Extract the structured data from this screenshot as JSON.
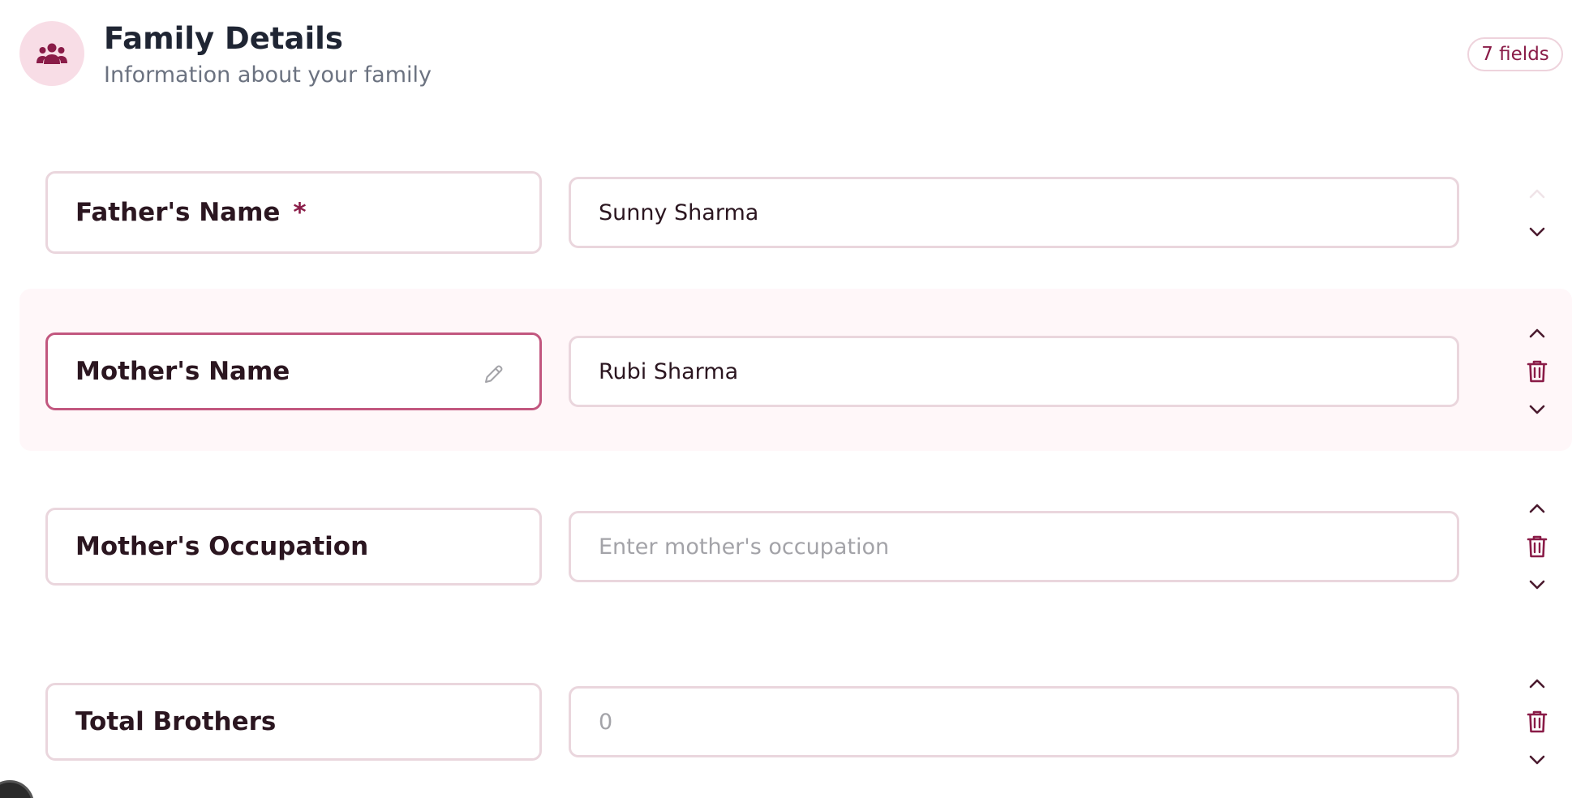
{
  "section": {
    "icon": "users-icon",
    "title": "Family Details",
    "subtitle": "Information about your family",
    "field_count": "7 fields"
  },
  "colors": {
    "accent": "#8a1c48",
    "icon_bg": "#f8dde6",
    "border": "#ead6dd",
    "selected_border": "#c2577f",
    "highlight_bg": "#fff7f9"
  },
  "fields": [
    {
      "label": "Father's Name",
      "required": true,
      "required_mark": "*",
      "value": "Sunny Sharma",
      "placeholder": "",
      "controls": [
        "chevron-up-icon (disabled)",
        "chevron-down-icon"
      ]
    },
    {
      "label": "Mother's Name",
      "required": false,
      "value": "Rubi Sharma",
      "placeholder": "",
      "selected": true,
      "controls": [
        "chevron-up-icon",
        "trash-icon",
        "chevron-down-icon"
      ]
    },
    {
      "label": "Mother's Occupation",
      "required": false,
      "value": "",
      "placeholder": "Enter mother's occupation",
      "controls": [
        "chevron-up-icon",
        "trash-icon",
        "chevron-down-icon"
      ]
    },
    {
      "label": "Total Brothers",
      "required": false,
      "value": "",
      "placeholder": "0",
      "controls": [
        "chevron-up-icon",
        "trash-icon",
        "chevron-down-icon"
      ]
    }
  ]
}
